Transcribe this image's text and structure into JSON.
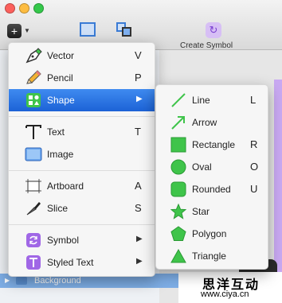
{
  "toolbar": {
    "add_label": "+",
    "create_symbol_label": "Create Symbol"
  },
  "layers": {
    "background_label": "Background"
  },
  "insert_menu": {
    "items": [
      {
        "label": "Vector",
        "shortcut": "V",
        "icon": "vector-pen-icon"
      },
      {
        "label": "Pencil",
        "shortcut": "P",
        "icon": "pencil-icon"
      },
      {
        "label": "Shape",
        "submenu": true,
        "icon": "shape-icon",
        "selected": true
      },
      {
        "label": "Text",
        "shortcut": "T",
        "icon": "text-icon"
      },
      {
        "label": "Image",
        "icon": "image-icon"
      },
      {
        "label": "Artboard",
        "shortcut": "A",
        "icon": "artboard-icon"
      },
      {
        "label": "Slice",
        "shortcut": "S",
        "icon": "slice-icon"
      },
      {
        "label": "Symbol",
        "submenu": true,
        "icon": "symbol-icon"
      },
      {
        "label": "Styled Text",
        "submenu": true,
        "icon": "styled-text-icon"
      }
    ]
  },
  "shape_submenu": {
    "items": [
      {
        "label": "Line",
        "shortcut": "L",
        "icon": "line-icon"
      },
      {
        "label": "Arrow",
        "shortcut": "",
        "icon": "arrow-icon"
      },
      {
        "label": "Rectangle",
        "shortcut": "R",
        "icon": "rectangle-icon"
      },
      {
        "label": "Oval",
        "shortcut": "O",
        "icon": "oval-icon"
      },
      {
        "label": "Rounded",
        "shortcut": "U",
        "icon": "rounded-rectangle-icon"
      },
      {
        "label": "Star",
        "shortcut": "",
        "icon": "star-icon"
      },
      {
        "label": "Polygon",
        "shortcut": "",
        "icon": "polygon-icon"
      },
      {
        "label": "Triangle",
        "shortcut": "",
        "icon": "triangle-icon"
      }
    ]
  },
  "watermark": {
    "chinese": "思洋互动",
    "url": "www.ciya.cn"
  },
  "colors": {
    "selection": "#2a73e3",
    "shape_green": "#3fc44a",
    "symbol_purple": "#a067e6"
  }
}
